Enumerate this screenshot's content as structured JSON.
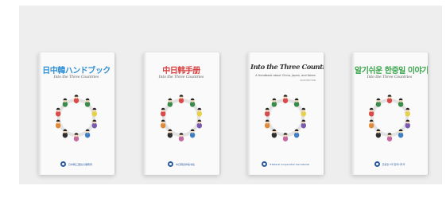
{
  "books": [
    {
      "title": "日中韓ハンドブック",
      "title_color": "#2f8fd6",
      "subtitle": "Into the Three Countries",
      "publisher": "日中韓三国協力事務局"
    },
    {
      "title": "中日韩手册",
      "title_color": "#d93c3c",
      "subtitle": "Into the Three Countries",
      "publisher": "中日韩合作秘书处"
    },
    {
      "title": "Into the Three Countries",
      "subtitle": "A Handbook about China, Japan, and Korea",
      "edition": "2020 EDITION",
      "publisher": "Trilateral Cooperation Secretariat"
    },
    {
      "title": "알기쉬운 한중일 이야기",
      "title_color": "#3aa64c",
      "subtitle": "Into the Three Countries",
      "publisher": "한중일 3국 협력사무국"
    }
  ],
  "colors": {
    "panel_bg": "#eeeeee",
    "logo_blue": "#2a5b9e"
  }
}
